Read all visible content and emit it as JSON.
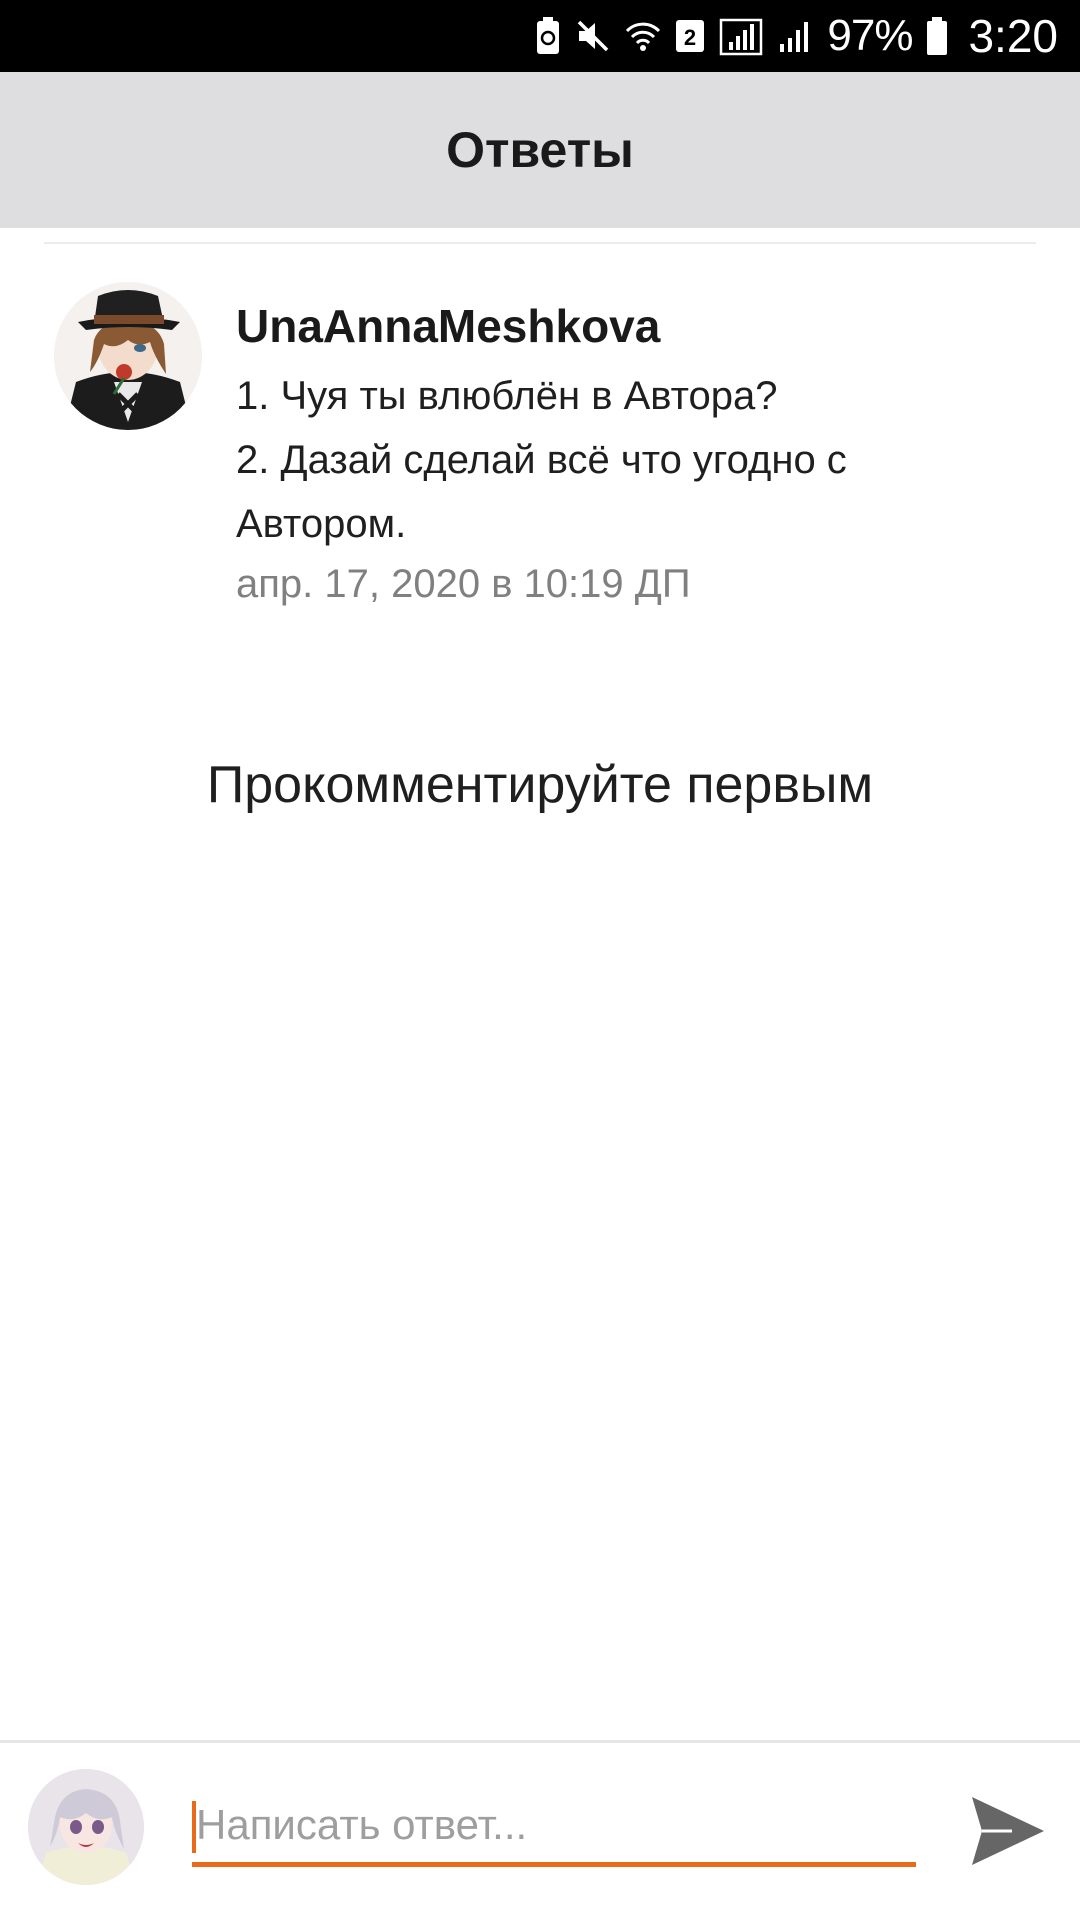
{
  "status_bar": {
    "icons": [
      "battery-saver-icon",
      "mute-icon",
      "wifi-icon",
      "sim-2-icon",
      "signal-icon",
      "signal-icon"
    ],
    "sim_number": "2",
    "battery": "97%",
    "time": "3:20"
  },
  "header": {
    "title": "Ответы"
  },
  "reply": {
    "author": "UnaAnnaMeshkova",
    "lines": [
      "1. Чуя ты влюблён в Автора?",
      "2. Дазай сделай всё что угодно с",
      "Автором."
    ],
    "timestamp": "апр. 17, 2020 в 10:19 ДП"
  },
  "empty_state": {
    "text": "Прокомментируйте первым"
  },
  "composer": {
    "placeholder": "Написать ответ...",
    "value": "",
    "send_icon": "send-icon"
  },
  "colors": {
    "accent": "#e86a1a",
    "header_bg": "#dedddf",
    "status_bar_bg": "#000000"
  }
}
